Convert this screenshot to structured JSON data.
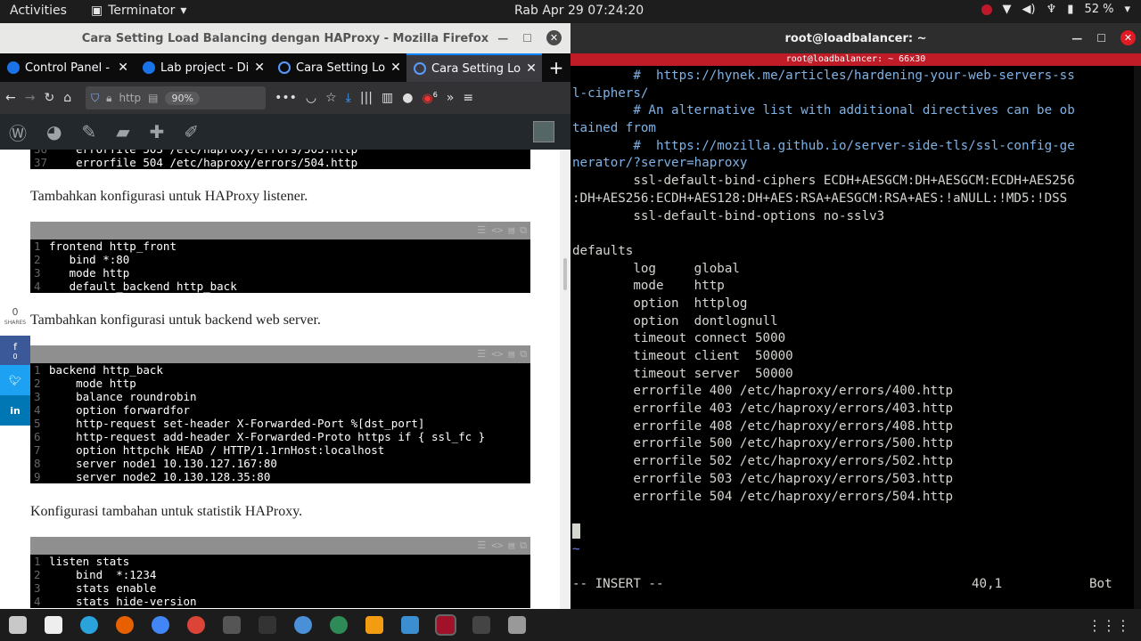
{
  "topbar": {
    "activities": "Activities",
    "app_name": "Terminator",
    "clock": "Rab Apr 29  07:24:20",
    "battery": "52 %"
  },
  "firefox": {
    "window_title": "Cara Setting Load Balancing dengan HAProxy - Mozilla Firefox",
    "tabs": [
      {
        "label": "Control Panel -"
      },
      {
        "label": "Lab project - Di"
      },
      {
        "label": "Cara Setting Lo"
      },
      {
        "label": "Cara Setting Lo"
      }
    ],
    "url_text": "http",
    "zoom": "90%",
    "badge_count": "6",
    "share": {
      "count": "0",
      "label": "SHARES",
      "fb_count": "0"
    },
    "page": {
      "code_top": [
        {
          "n": "36",
          "text": "    errorfile 503 /etc/haproxy/errors/503.http"
        },
        {
          "n": "37",
          "text": "    errorfile 504 /etc/haproxy/errors/504.http"
        }
      ],
      "para1": "Tambahkan konfigurasi untuk HAProxy listener.",
      "code_frontend": [
        {
          "n": "1",
          "text": "frontend http_front"
        },
        {
          "n": "2",
          "text": "   bind *:80"
        },
        {
          "n": "3",
          "text": "   mode http"
        },
        {
          "n": "4",
          "text": "   default_backend http_back"
        }
      ],
      "para2": "Tambahkan konfigurasi untuk backend web server.",
      "code_backend": [
        {
          "n": "1",
          "text": "backend http_back"
        },
        {
          "n": "2",
          "text": "    mode http"
        },
        {
          "n": "3",
          "text": "    balance roundrobin"
        },
        {
          "n": "4",
          "text": "    option forwardfor"
        },
        {
          "n": "5",
          "text": "    http-request set-header X-Forwarded-Port %[dst_port]"
        },
        {
          "n": "6",
          "text": "    http-request add-header X-Forwarded-Proto https if { ssl_fc }"
        },
        {
          "n": "7",
          "text": "    option httpchk HEAD / HTTP/1.1rnHost:localhost"
        },
        {
          "n": "8",
          "text": "    server node1 10.130.127.167:80"
        },
        {
          "n": "9",
          "text": "    server node2 10.130.128.35:80"
        }
      ],
      "para3": "Konfigurasi tambahan untuk statistik HAProxy.",
      "code_stats": [
        {
          "n": "1",
          "text": "listen stats"
        },
        {
          "n": "2",
          "text": "    bind  *:1234"
        },
        {
          "n": "3",
          "text": "    stats enable"
        },
        {
          "n": "4",
          "text": "    stats hide-version"
        }
      ]
    }
  },
  "terminal": {
    "window_title": "root@loadbalancer: ~",
    "subtitle": "root@loadbalancer: ~ 66x30",
    "lines": [
      {
        "t": "        #  https://hynek.me/articles/hardening-your-web-servers-ss",
        "c": "cmt"
      },
      {
        "t": "l-ciphers/",
        "c": "cmt"
      },
      {
        "t": "        # An alternative list with additional directives can be ob",
        "c": "cmt"
      },
      {
        "t": "tained from",
        "c": "cmt"
      },
      {
        "t": "        #  https://mozilla.github.io/server-side-tls/ssl-config-ge",
        "c": "cmt"
      },
      {
        "t": "nerator/?server=haproxy",
        "c": "cmt"
      },
      {
        "t": "        ssl-default-bind-ciphers ECDH+AESGCM:DH+AESGCM:ECDH+AES256",
        "c": ""
      },
      {
        "t": ":DH+AES256:ECDH+AES128:DH+AES:RSA+AESGCM:RSA+AES:!aNULL:!MD5:!DSS",
        "c": ""
      },
      {
        "t": "        ssl-default-bind-options no-sslv3",
        "c": ""
      },
      {
        "t": "",
        "c": ""
      },
      {
        "t": "defaults",
        "c": ""
      },
      {
        "t": "        log     global",
        "c": ""
      },
      {
        "t": "        mode    http",
        "c": ""
      },
      {
        "t": "        option  httplog",
        "c": ""
      },
      {
        "t": "        option  dontlognull",
        "c": ""
      },
      {
        "t": "        timeout connect 5000",
        "c": ""
      },
      {
        "t": "        timeout client  50000",
        "c": ""
      },
      {
        "t": "        timeout server  50000",
        "c": ""
      },
      {
        "t": "        errorfile 400 /etc/haproxy/errors/400.http",
        "c": ""
      },
      {
        "t": "        errorfile 403 /etc/haproxy/errors/403.http",
        "c": ""
      },
      {
        "t": "        errorfile 408 /etc/haproxy/errors/408.http",
        "c": ""
      },
      {
        "t": "        errorfile 500 /etc/haproxy/errors/500.http",
        "c": ""
      },
      {
        "t": "        errorfile 502 /etc/haproxy/errors/502.http",
        "c": ""
      },
      {
        "t": "        errorfile 503 /etc/haproxy/errors/503.http",
        "c": ""
      },
      {
        "t": "        errorfile 504 /etc/haproxy/errors/504.http",
        "c": ""
      },
      {
        "t": "",
        "c": ""
      },
      {
        "t": "",
        "c": "cursorline"
      },
      {
        "t": "~",
        "c": "tilde"
      }
    ],
    "mode": "-- INSERT --",
    "position": "40,1",
    "scroll": "Bot"
  }
}
